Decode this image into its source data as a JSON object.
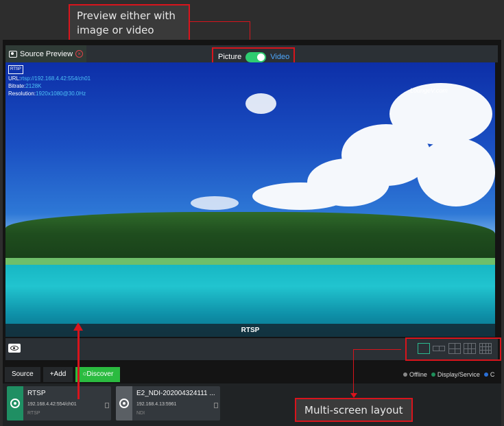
{
  "callouts": {
    "preview": "Preview either with image or video",
    "multi_screen": "Multi-screen layout"
  },
  "topbar": {
    "tab_label": "Source Preview",
    "toggle_left": "Picture",
    "toggle_right": "Video"
  },
  "preview": {
    "badge": "RTSP",
    "url_label": "URL:",
    "url_value": "rtsp://192.168.4.42:554/ch01",
    "bitrate_label": "Bitrate:",
    "bitrate_value": "2128K",
    "resolution_label": "Resolution:",
    "resolution_value": "1920x1080@30.0Hz",
    "watermark": "LoungeV.com",
    "source_label": "RTSP"
  },
  "toolbar": {
    "source": "Source",
    "add": "+Add",
    "discover": "Discover"
  },
  "legend": {
    "offline": "Offline",
    "display_service": "Display/Service",
    "third": "C"
  },
  "colors": {
    "offline": "#888888",
    "display_service": "#1e8f5a",
    "third": "#2a6fd6"
  },
  "cards": [
    {
      "name": "RTSP",
      "address": "192.168.4.42:554/ch01",
      "type": "RTSP",
      "icon_color": "#1f8f63"
    },
    {
      "name": "E2_NDI-202004324111 ...",
      "address": "192.168.4.13:5961",
      "type": "NDI",
      "icon_color": "#5a5f64"
    }
  ]
}
